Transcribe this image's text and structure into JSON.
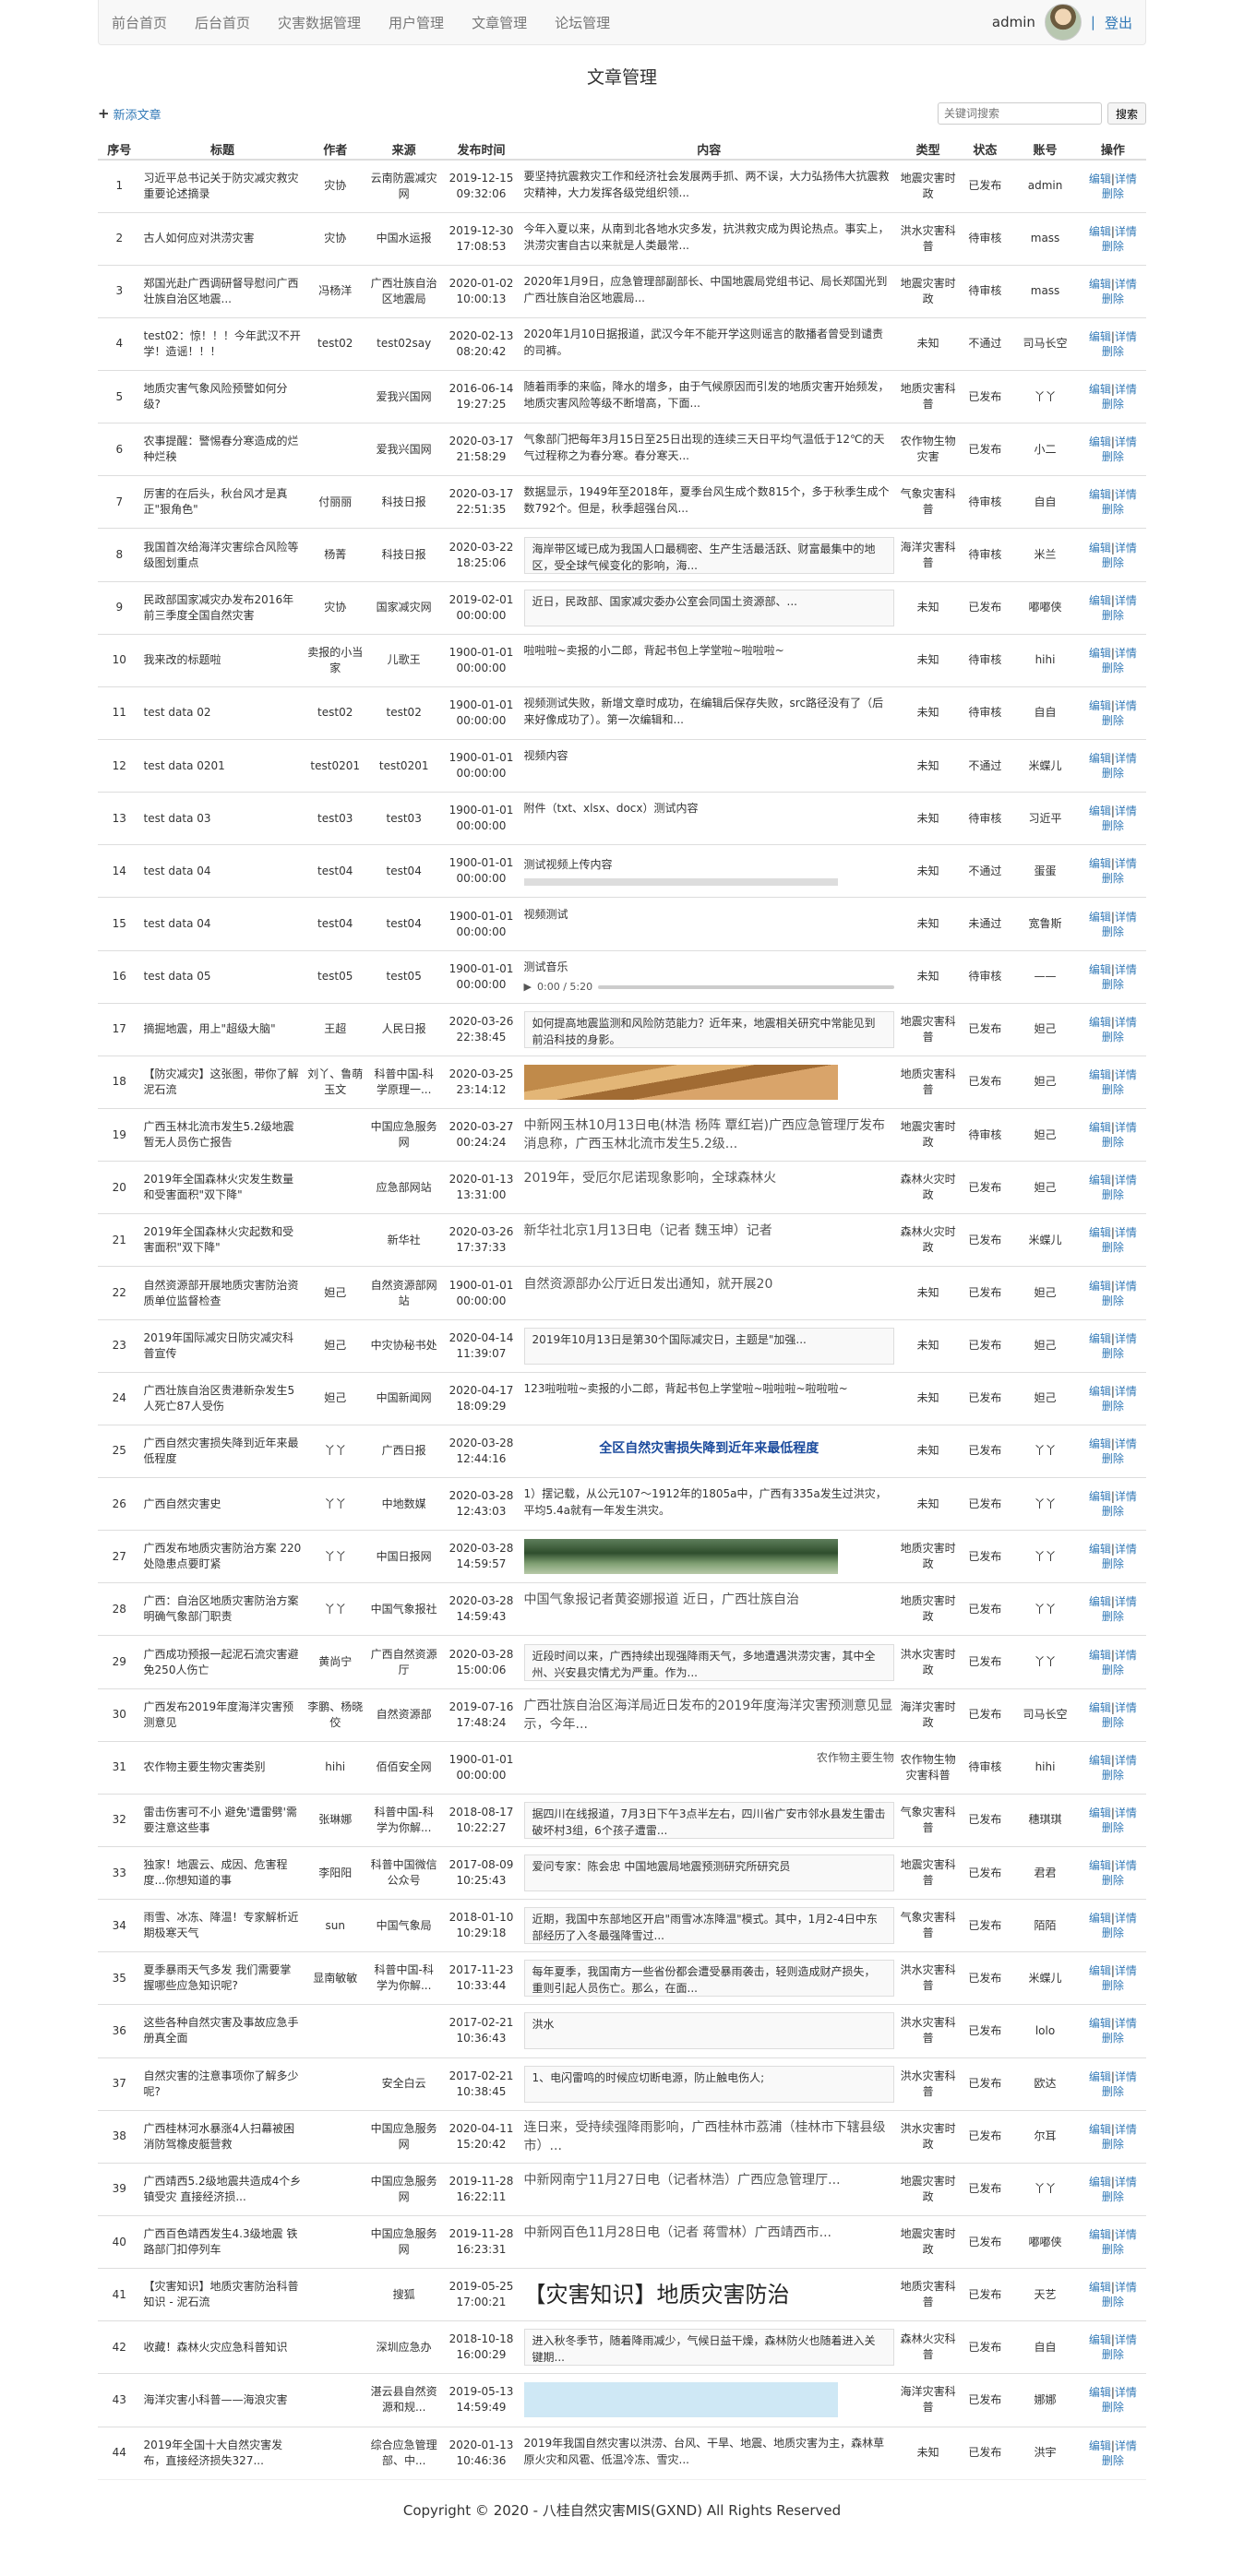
{
  "nav": {
    "links": [
      "前台首页",
      "后台首页",
      "灾害数据管理",
      "用户管理",
      "文章管理",
      "论坛管理"
    ],
    "user": "admin",
    "separator": "|",
    "logout": "登出"
  },
  "page": {
    "title": "文章管理",
    "add_link": "新添文章",
    "search_placeholder": "关键词搜索",
    "search_button": "搜索"
  },
  "table": {
    "headers": [
      "序号",
      "标题",
      "作者",
      "来源",
      "发布时间",
      "内容",
      "类型",
      "状态",
      "账号",
      "操作"
    ],
    "op_edit": "编辑",
    "op_detail": "详情",
    "op_delete": "删除",
    "op_sep": "|",
    "rows": [
      {
        "no": "1",
        "title": "习近平总书记关于防灾减灾救灾重要论述摘录",
        "author": "灾协",
        "source": "云南防震减灾网",
        "time": "2019-12-15 09:32:06",
        "content": "要坚持抗震救灾工作和经济社会发展两手抓、两不误，大力弘扬伟大抗震救灾精神，大力发挥各级党组织领...",
        "ctype": "text",
        "type": "地震灾害时政",
        "status": "已发布",
        "account": "admin"
      },
      {
        "no": "2",
        "title": "古人如何应对洪涝灾害",
        "author": "灾协",
        "source": "中国水运报",
        "time": "2019-12-30 17:08:53",
        "content": "今年入夏以来，从南到北各地水灾多发，抗洪救灾成为舆论热点。事实上，洪涝灾害自古以来就是人类最常...",
        "ctype": "text",
        "type": "洪水灾害科普",
        "status": "待审核",
        "account": "mass"
      },
      {
        "no": "3",
        "title": "郑国光赴广西调研督导慰问广西壮族自治区地震...",
        "author": "冯杨洋",
        "source": "广西壮族自治区地震局",
        "time": "2020-01-02 10:00:13",
        "content": "2020年1月9日，应急管理部副部长、中国地震局党组书记、局长郑国光到广西壮族自治区地震局...",
        "ctype": "text",
        "type": "地震灾害时政",
        "status": "待审核",
        "account": "mass"
      },
      {
        "no": "4",
        "title": "test02：惊！！！今年武汉不开学！造谣！！！",
        "author": "test02",
        "source": "test02say",
        "time": "2020-02-13 08:20:42",
        "content": "2020年1月10日据报道，武汉今年不能开学这则谣言的散播者曾受到谴责的司裤。",
        "ctype": "text",
        "type": "未知",
        "status": "不通过",
        "account": "司马长空"
      },
      {
        "no": "5",
        "title": "地质灾害气象风险预警如何分级?",
        "author": "",
        "source": "爱我兴国网",
        "time": "2016-06-14 19:27:25",
        "content": "随着雨季的来临，降水的增多，由于气候原因而引发的地质灾害开始频发，地质灾害风险等级不断增高，下面...",
        "ctype": "text",
        "type": "地质灾害科普",
        "status": "已发布",
        "account": "丫丫"
      },
      {
        "no": "6",
        "title": "农事提醒：警惕春分寒造成的烂种烂秧",
        "author": "",
        "source": "爱我兴国网",
        "time": "2020-03-17 21:58:29",
        "content": "气象部门把每年3月15日至25日出现的连续三天日平均气温低于12℃的天气过程称之为春分寒。春分寒天...",
        "ctype": "text",
        "type": "农作物生物灾害",
        "status": "已发布",
        "account": "小二"
      },
      {
        "no": "7",
        "title": "厉害的在后头，秋台风才是真正\"狠角色\"",
        "author": "付丽丽",
        "source": "科技日报",
        "time": "2020-03-17 22:51:35",
        "content": "数据显示，1949年至2018年，夏季台风生成个数815个，多于秋季生成个数792个。但是，秋季超强台风...",
        "ctype": "text",
        "type": "气象灾害科普",
        "status": "待审核",
        "account": "自自"
      },
      {
        "no": "8",
        "title": "我国首次给海洋灾害综合风险等级图划重点",
        "author": "杨菁",
        "source": "科技日报",
        "time": "2020-03-22 18:25:06",
        "content": "海岸带区域已成为我国人口最稠密、生产生活最活跃、财富最集中的地区，受全球气候变化的影响，海...",
        "ctype": "boxed",
        "type": "海洋灾害科普",
        "status": "待审核",
        "account": "米兰"
      },
      {
        "no": "9",
        "title": "民政部国家减灾办发布2016年前三季度全国自然灾害",
        "author": "灾协",
        "source": "国家减灾网",
        "time": "2019-02-01 00:00:00",
        "content": "近日，民政部、国家减灾委办公室会同国土资源部、...",
        "ctype": "boxed",
        "type": "未知",
        "status": "已发布",
        "account": "嘟嘟侠"
      },
      {
        "no": "10",
        "title": "我来改的标题啦",
        "author": "卖报的小当家",
        "source": "儿歌王",
        "time": "1900-01-01 00:00:00",
        "content": "啦啦啦~卖报的小二郎，背起书包上学堂啦~啦啦啦~",
        "ctype": "text",
        "type": "未知",
        "status": "待审核",
        "account": "hihi"
      },
      {
        "no": "11",
        "title": "test data 02",
        "author": "test02",
        "source": "test02",
        "time": "1900-01-01 00:00:00",
        "content": "视频测试失败，新增文章时成功，在编辑后保存失败，src路径没有了（后来好像成功了）。第一次编辑和...",
        "ctype": "text",
        "type": "未知",
        "status": "待审核",
        "account": "自自"
      },
      {
        "no": "12",
        "title": "test data 0201",
        "author": "test0201",
        "source": "test0201",
        "time": "1900-01-01 00:00:00",
        "content": "视频内容",
        "ctype": "text",
        "type": "未知",
        "status": "不通过",
        "account": "米蝶儿"
      },
      {
        "no": "13",
        "title": "test data 03",
        "author": "test03",
        "source": "test03",
        "time": "1900-01-01 00:00:00",
        "content": "附件（txt、xlsx、docx）测试内容",
        "ctype": "text",
        "type": "未知",
        "status": "待审核",
        "account": "习近平"
      },
      {
        "no": "14",
        "title": "test data 04",
        "author": "test04",
        "source": "test04",
        "time": "1900-01-01 00:00:00",
        "content": "测试视频上传内容",
        "ctype": "video",
        "type": "未知",
        "status": "不通过",
        "account": "蛋蛋"
      },
      {
        "no": "15",
        "title": "test data 04",
        "author": "test04",
        "source": "test04",
        "time": "1900-01-01 00:00:00",
        "content": "视频测试",
        "ctype": "text",
        "type": "未知",
        "status": "未通过",
        "account": "宽鲁斯"
      },
      {
        "no": "16",
        "title": "test data 05",
        "author": "test05",
        "source": "test05",
        "time": "1900-01-01 00:00:00",
        "content": "测试音乐",
        "ctype": "audio",
        "audio_time": "0:00 / 5:20",
        "type": "未知",
        "status": "待审核",
        "account": "——"
      },
      {
        "no": "17",
        "title": "摘掘地震，用上\"超级大脑\"",
        "author": "王超",
        "source": "人民日报",
        "time": "2020-03-26 22:38:45",
        "content": "如何提高地震监测和风险防范能力？近年来，地震相关研究中常能见到前沿科技的身影。",
        "ctype": "boxed",
        "type": "地震灾害科普",
        "status": "已发布",
        "account": "妲己"
      },
      {
        "no": "18",
        "title": "【防灾减灾】这张图，带你了解泥石流",
        "author": "刘丫、鲁萌玉文",
        "source": "科普中国-科学原理一...",
        "time": "2020-03-25 23:14:12",
        "content": "",
        "ctype": "img-mountain",
        "type": "地质灾害科普",
        "status": "已发布",
        "account": "妲己"
      },
      {
        "no": "19",
        "title": "广西玉林北流市发生5.2级地震 暂无人员伤亡报告",
        "author": "",
        "source": "中国应急服务网",
        "time": "2020-03-27 00:24:24",
        "content": "中新网玉林10月13日电(林浩 杨阵 覃红岩)广西应急管理厅发布消息称，广西玉林北流市发生5.2级...",
        "ctype": "big",
        "type": "地震灾害时政",
        "status": "待审核",
        "account": "妲己"
      },
      {
        "no": "20",
        "title": "2019年全国森林火灾发生数量和受害面积\"双下降\"",
        "author": "",
        "source": "应急部网站",
        "time": "2020-01-13 13:31:00",
        "content": "2019年，受厄尔尼诺现象影响，全球森林火",
        "ctype": "big",
        "type": "森林火灾时政",
        "status": "已发布",
        "account": "妲己"
      },
      {
        "no": "21",
        "title": "2019年全国森林火灾起数和受害面积\"双下降\"",
        "author": "",
        "source": "新华社",
        "time": "2020-03-26 17:37:33",
        "content": "新华社北京1月13日电（记者 魏玉坤）记者",
        "ctype": "big",
        "type": "森林火灾时政",
        "status": "已发布",
        "account": "米蝶儿"
      },
      {
        "no": "22",
        "title": "自然资源部开展地质灾害防治资质单位监督检查",
        "author": "妲己",
        "source": "自然资源部网站",
        "time": "1900-01-01 00:00:00",
        "content": "自然资源部办公厅近日发出通知，就开展20",
        "ctype": "big",
        "type": "未知",
        "status": "已发布",
        "account": "妲己"
      },
      {
        "no": "23",
        "title": "2019年国际减灾日防灾减灾科普宣传",
        "author": "妲己",
        "source": "中灾协秘书处",
        "time": "2020-04-14 11:39:07",
        "content": "2019年10月13日是第30个国际减灾日，主题是\"加强...",
        "ctype": "boxed",
        "type": "未知",
        "status": "已发布",
        "account": "妲己"
      },
      {
        "no": "24",
        "title": "广西壮族自治区贵港新杂发生5人死亡87人受伤",
        "author": "妲己",
        "source": "中国新闻网",
        "time": "2020-04-17 18:09:29",
        "content": "123啦啦啦~卖报的小二郎，背起书包上学堂啦~啦啦啦~啦啦啦~",
        "ctype": "text",
        "type": "未知",
        "status": "已发布",
        "account": "妲己"
      },
      {
        "no": "25",
        "title": "广西自然灾害损失降到近年来最低程度",
        "author": "丫丫",
        "source": "广西日报",
        "time": "2020-03-28 12:44:16",
        "content": "全区自然灾害损失降到近年来最低程度",
        "ctype": "bold",
        "type": "未知",
        "status": "已发布",
        "account": "丫丫"
      },
      {
        "no": "26",
        "title": "广西自然灾害史",
        "author": "丫丫",
        "source": "中地数媒",
        "time": "2020-03-28 12:43:03",
        "content": "1）摆记载，从公元107～1912年的1805a中，广西有335a发生过洪灾，平均5.4a就有一年发生洪灾。",
        "ctype": "text",
        "type": "未知",
        "status": "已发布",
        "account": "丫丫"
      },
      {
        "no": "27",
        "title": "广西发布地质灾害防治方案 220处隐患点要盯紧",
        "author": "丫丫",
        "source": "中国日报网",
        "time": "2020-03-28 14:59:57",
        "content": "",
        "ctype": "img-forest",
        "type": "地质灾害时政",
        "status": "已发布",
        "account": "丫丫"
      },
      {
        "no": "28",
        "title": "广西：自治区地质灾害防治方案明确气象部门职责",
        "author": "丫丫",
        "source": "中国气象报社",
        "time": "2020-03-28 14:59:43",
        "content": "中国气象报记者黄姿娜报道 近日，广西壮族自治",
        "ctype": "big",
        "type": "地质灾害时政",
        "status": "已发布",
        "account": "丫丫"
      },
      {
        "no": "29",
        "title": "广西成功预报一起泥石流灾害避免250人伤亡",
        "author": "黄尚宁",
        "source": "广西自然资源厅",
        "time": "2020-03-28 15:00:06",
        "content": "近段时间以来，广西持续出现强降雨天气，多地遭遇洪涝灾害，其中全州、兴安县灾情尤为严重。作为...",
        "ctype": "boxed",
        "type": "洪水灾害时政",
        "status": "已发布",
        "account": "丫丫"
      },
      {
        "no": "30",
        "title": "广西发布2019年度海洋灾害预测意见",
        "author": "李鹏、杨晓佼",
        "source": "自然资源部",
        "time": "2019-07-16 17:48:24",
        "content": "广西壮族自治区海洋局近日发布的2019年度海洋灾害预测意见显示，今年...",
        "ctype": "big",
        "type": "海洋灾害时政",
        "status": "已发布",
        "account": "司马长空"
      },
      {
        "no": "31",
        "title": "农作物主要生物灾害类别",
        "author": "hihi",
        "source": "佰佰安全网",
        "time": "1900-01-01 00:00:00",
        "content": "农作物主要生物",
        "ctype": "broken",
        "type": "农作物生物灾害科普",
        "status": "待审核",
        "account": "hihi"
      },
      {
        "no": "32",
        "title": "雷击伤害可不小 避免'遭雷劈'需要注意这些事",
        "author": "张琳娜",
        "source": "科普中国-科学为你解...",
        "time": "2018-08-17 10:22:27",
        "content": "据四川在线报道，7月3日下午3点半左右，四川省广安市邻水县发生雷击破坏村3组，6个孩子遭雷...",
        "ctype": "boxed",
        "type": "气象灾害科普",
        "status": "已发布",
        "account": "穗琪琪"
      },
      {
        "no": "33",
        "title": "独家！地震云、成因、危害程度...你想知道的事",
        "author": "李阳阳",
        "source": "科普中国微信公众号",
        "time": "2017-08-09 10:25:43",
        "content": "爱问专家：陈会忠 中国地震局地震预测研究所研究员",
        "ctype": "boxed",
        "type": "地震灾害科普",
        "status": "已发布",
        "account": "君君"
      },
      {
        "no": "34",
        "title": "雨雪、冰冻、降温！专家解析近期极寒天气",
        "author": "sun",
        "source": "中国气象局",
        "time": "2018-01-10 10:29:18",
        "content": "近期，我国中东部地区开启\"雨雪冰冻降温\"模式。其中，1月2-4日中东部经历了入冬最强降雪过...",
        "ctype": "boxed",
        "type": "气象灾害科普",
        "status": "已发布",
        "account": "陌陌"
      },
      {
        "no": "35",
        "title": "夏季暴雨天气多发 我们需要掌握哪些应急知识呢?",
        "author": "显南敏敏",
        "source": "科普中国-科学为你解...",
        "time": "2017-11-23 10:33:44",
        "content": "每年夏季，我国南方一些省份都会遭受暴雨袭击，轻则造成财产损失，重则引起人员伤亡。那么，在面...",
        "ctype": "boxed",
        "type": "洪水灾害科普",
        "status": "已发布",
        "account": "米蝶儿"
      },
      {
        "no": "36",
        "title": "这些各种自然灾害及事故应急手册真全面",
        "author": "",
        "source": "",
        "time": "2017-02-21 10:36:43",
        "content": "洪水",
        "ctype": "boxed",
        "type": "洪水灾害科普",
        "status": "已发布",
        "account": "lolo"
      },
      {
        "no": "37",
        "title": "自然灾害的注意事项你了解多少呢?",
        "author": "",
        "source": "安全白云",
        "time": "2017-02-21 10:38:45",
        "content": "1、电闪雷鸣的时候应切断电源，防止触电伤人;",
        "ctype": "boxed",
        "type": "洪水灾害科普",
        "status": "已发布",
        "account": "欧达"
      },
      {
        "no": "38",
        "title": "广西桂林河水暴涨4人扫幕被困 消防驾橡皮艇营救",
        "author": "",
        "source": "中国应急服务网",
        "time": "2020-04-11 15:20:42",
        "content": "连日来，受持续强降雨影响，广西桂林市荔浦（桂林市下辖县级市）...",
        "ctype": "big",
        "type": "洪水灾害时政",
        "status": "已发布",
        "account": "尔耳"
      },
      {
        "no": "39",
        "title": "广西靖西5.2级地震共造成4个乡镇受灾 直接经济损...",
        "author": "",
        "source": "中国应急服务网",
        "time": "2019-11-28 16:22:11",
        "content": "中新网南宁11月27日电（记者林浩）广西应急管理厅...",
        "ctype": "big",
        "type": "地震灾害时政",
        "status": "已发布",
        "account": "丫丫"
      },
      {
        "no": "40",
        "title": "广西百色靖西发生4.3级地震 铁路部门扣停列车",
        "author": "",
        "source": "中国应急服务网",
        "time": "2019-11-28 16:23:31",
        "content": "中新网百色11月28日电（记者 蒋雪林）广西靖西市...",
        "ctype": "big",
        "type": "地震灾害时政",
        "status": "已发布",
        "account": "嘟嘟侠"
      },
      {
        "no": "41",
        "title": "【灾害知识】地质灾害防治科普知识 - 泥石流",
        "author": "",
        "source": "搜狐",
        "time": "2019-05-25 17:00:21",
        "content": "【灾害知识】地质灾害防治",
        "ctype": "xl",
        "type": "地质灾害科普",
        "status": "已发布",
        "account": "天艺"
      },
      {
        "no": "42",
        "title": "收藏！森林火灾应急科普知识",
        "author": "",
        "source": "深圳应急办",
        "time": "2018-10-18 16:00:29",
        "content": "进入秋冬季节，随着降雨减少，气候日益干燥，森林防火也随着进入关键期...",
        "ctype": "boxed",
        "type": "森林火灾科普",
        "status": "已发布",
        "account": "自自"
      },
      {
        "no": "43",
        "title": "海洋灾害小科普——海浪灾害",
        "author": "",
        "source": "湛云县自然资源和规...",
        "time": "2019-05-13 14:59:49",
        "content": "",
        "ctype": "img-sea",
        "type": "海洋灾害科普",
        "status": "已发布",
        "account": "娜娜"
      },
      {
        "no": "44",
        "title": "2019年全国十大自然灾害发布，直接经济损失327...",
        "author": "",
        "source": "综合应急管理部、中...",
        "time": "2020-01-13 10:46:36",
        "content": "2019年我国自然灾害以洪涝、台风、干旱、地震、地质灾害为主，森林草原火灾和风雹、低温冷冻、雪灾...",
        "ctype": "text",
        "type": "未知",
        "status": "已发布",
        "account": "洪宇"
      }
    ]
  },
  "footer": "Copyright © 2020 - 八桂自然灾害MIS(GXND) All Rights Reserved"
}
